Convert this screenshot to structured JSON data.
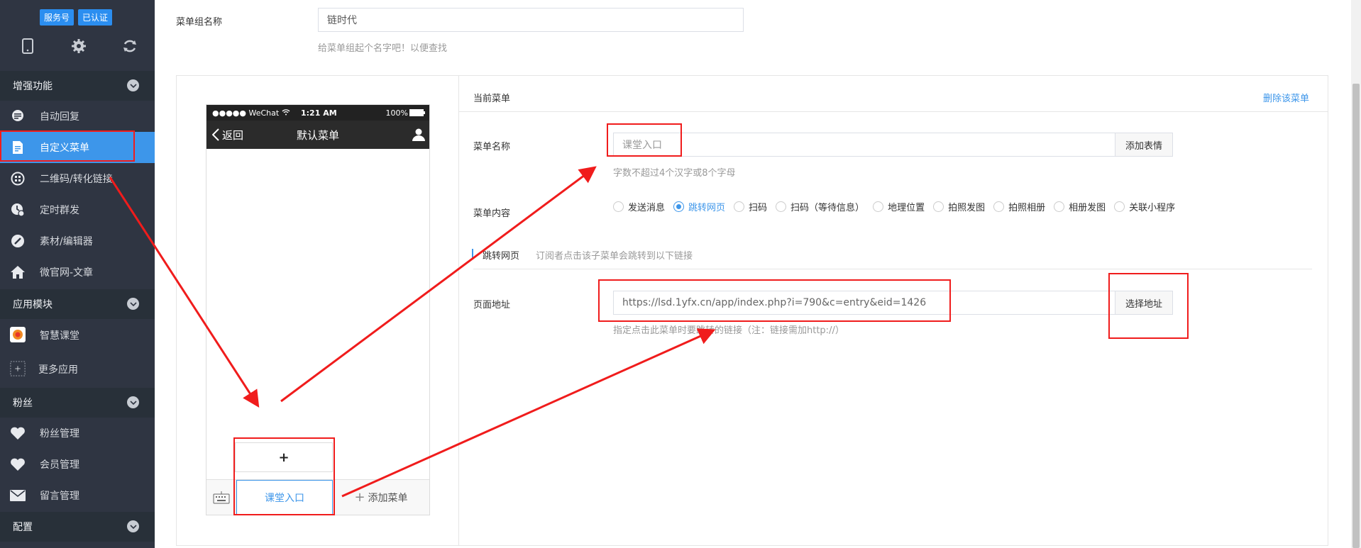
{
  "account": {
    "badge_type": "服务号",
    "badge_verified": "已认证"
  },
  "top_icons": [
    "phone-icon",
    "gear-icon",
    "refresh-icon"
  ],
  "sidebar": {
    "sections": [
      {
        "label": "增强功能"
      },
      {
        "label": "应用模块"
      },
      {
        "label": "粉丝"
      },
      {
        "label": "配置"
      }
    ],
    "items": [
      {
        "label": "自动回复",
        "icon": "chat-bubble-icon"
      },
      {
        "label": "自定义菜单",
        "icon": "document-icon",
        "active": true
      },
      {
        "label": "二维码/转化链接",
        "icon": "qrcode-icon"
      },
      {
        "label": "定时群发",
        "icon": "clock-icon"
      },
      {
        "label": "素材/编辑器",
        "icon": "pencil-icon"
      },
      {
        "label": "微官网-文章",
        "icon": "home-icon"
      },
      {
        "label": "智慧课堂",
        "icon": "classroom-app-icon"
      },
      {
        "label": "更多应用",
        "icon": "plus-box-icon"
      },
      {
        "label": "粉丝管理",
        "icon": "heart-hand-icon"
      },
      {
        "label": "会员管理",
        "icon": "heart-icon"
      },
      {
        "label": "留言管理",
        "icon": "envelope-icon"
      }
    ]
  },
  "menu_group": {
    "label": "菜单组名称",
    "value": "链时代",
    "hint": "给菜单组起个名字吧！以便查找"
  },
  "phone": {
    "carrier": "●●●●● WeChat",
    "time": "1:21 AM",
    "battery": "100%",
    "back": "返回",
    "title": "默认菜单",
    "sub_add": "+",
    "menu_item": "课堂入口",
    "add_menu": "添加菜单"
  },
  "editor": {
    "current_menu": "当前菜单",
    "delete_link": "删除该菜单",
    "name_label": "菜单名称",
    "name_placeholder": "课堂入口",
    "add_emoji": "添加表情",
    "name_hint": "字数不超过4个汉字或8个字母",
    "content_label": "菜单内容",
    "content_options": [
      "发送消息",
      "跳转网页",
      "扫码",
      "扫码（等待信息）",
      "地理位置",
      "拍照发图",
      "拍照相册",
      "相册发图",
      "关联小程序"
    ],
    "content_selected": "跳转网页",
    "jump_tab": "跳转网页",
    "jump_desc": "订阅者点击该子菜单会跳转到以下链接",
    "url_label": "页面地址",
    "url_value": "https://lsd.1yfx.cn/app/index.php?i=790&c=entry&eid=1426",
    "choose_address": "选择地址",
    "url_hint": "指定点击此菜单时要跳转的链接（注：链接需加http://）"
  },
  "colors": {
    "sidebar_bg": "#2f3542",
    "accent": "#3d96ea",
    "annotation_red": "#f01c1c"
  }
}
